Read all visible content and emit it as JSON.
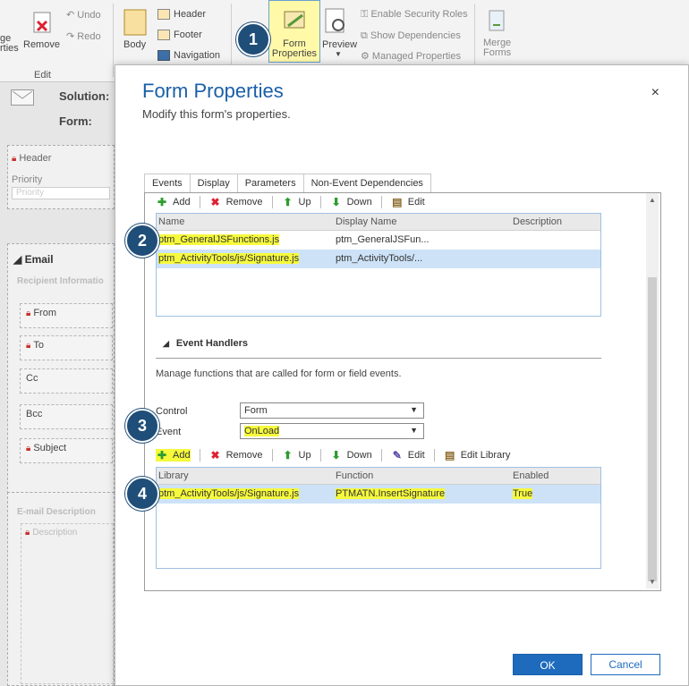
{
  "ribbon": {
    "merge_properties": "ge\nrties",
    "remove": "Remove",
    "undo": "Undo",
    "redo": "Redo",
    "edit_group": "Edit",
    "body": "Body",
    "header": "Header",
    "footer": "Footer",
    "navigation": "Navigation",
    "form_properties": "Form\nProperties",
    "preview": "Preview",
    "enable_security_roles": "Enable Security Roles",
    "show_dependencies": "Show Dependencies",
    "managed_properties": "Managed Properties",
    "merge_forms": "Merge\nForms"
  },
  "background": {
    "solution_label": "Solution:",
    "form_label": "Form:",
    "header_section": "Header",
    "priority_label": "Priority",
    "priority_placeholder": "Priority",
    "email_section": "Email",
    "recipient_info": "Recipient Informatio",
    "fields": [
      "From",
      "To",
      "Cc",
      "Bcc",
      "Subject"
    ],
    "email_description": "E-mail Description",
    "description": "Description"
  },
  "dialog": {
    "title": "Form Properties",
    "subtitle": "Modify this form's properties.",
    "close": "×",
    "tabs": [
      "Events",
      "Display",
      "Parameters",
      "Non-Event Dependencies"
    ],
    "library_toolbar": {
      "add": "Add",
      "remove": "Remove",
      "up": "Up",
      "down": "Down",
      "edit": "Edit"
    },
    "library_grid": {
      "headers": [
        "Name",
        "Display Name",
        "Description"
      ],
      "rows": [
        {
          "name": "ptm_GeneralJSFunctions.js",
          "display": "ptm_GeneralJSFun...",
          "description": ""
        },
        {
          "name": "ptm_ActivityTools/js/Signature.js",
          "display": "ptm_ActivityTools/...",
          "description": ""
        }
      ]
    },
    "event_handlers": {
      "title": "Event Handlers",
      "description": "Manage functions that are called for form or field events.",
      "control_label": "Control",
      "control_value": "Form",
      "event_label": "Event",
      "event_value": "OnLoad"
    },
    "handler_toolbar": {
      "add": "Add",
      "remove": "Remove",
      "up": "Up",
      "down": "Down",
      "edit": "Edit",
      "edit_library": "Edit Library"
    },
    "handler_grid": {
      "headers": [
        "Library",
        "Function",
        "Enabled"
      ],
      "rows": [
        {
          "library": "ptm_ActivityTools/js/Signature.js",
          "function": "PTMATN.InsertSignature",
          "enabled": "True"
        }
      ]
    },
    "ok": "OK",
    "cancel": "Cancel"
  },
  "steps": [
    "1",
    "2",
    "3",
    "4"
  ],
  "colors": {
    "accent": "#1a5fa8",
    "highlight": "#f6fa3c",
    "selection": "#cde2f7",
    "badge": "#1f4e79"
  }
}
